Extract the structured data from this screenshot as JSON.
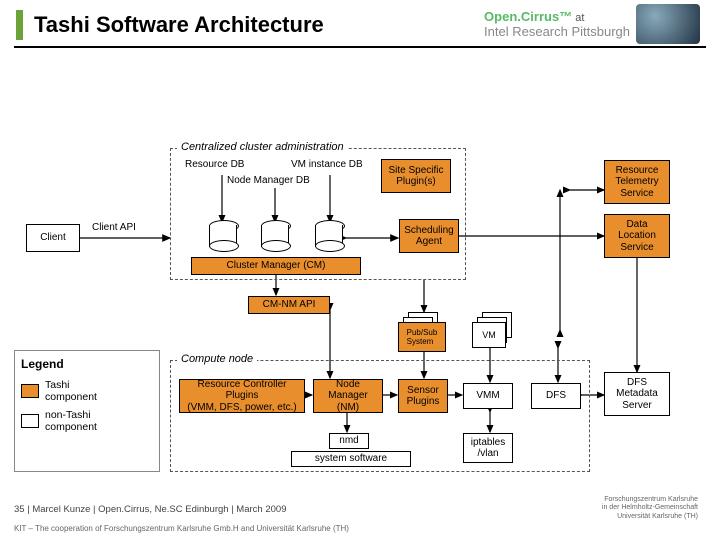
{
  "title": "Tashi Software Architecture",
  "header": {
    "brand1_pre": "Open",
    "brand1_post": "Cirrus™",
    "joiner": "at",
    "brand2": "Intel Research Pittsburgh"
  },
  "groups": {
    "admin": "Centralized cluster administration",
    "compute": "Compute node"
  },
  "labels": {
    "resource_db": "Resource DB",
    "vm_db": "VM instance DB",
    "node_mgr_db": "Node Manager DB",
    "site_plugins": "Site Specific\nPlugin(s)",
    "client_api": "Client API",
    "scheduling_agent": "Scheduling\nAgent",
    "cluster_manager": "Cluster Manager (CM)",
    "cm_nm_api": "CM-NM API",
    "pub_sub": "Pub/Sub\nSystem",
    "vm": "VM",
    "client": "Client",
    "rc_plugins": "Resource Controller Plugins\n(VMM, DFS, power, etc.)",
    "node_manager": "Node Manager\n(NM)",
    "sensor_plugins": "Sensor\nPlugins",
    "vmm": "VMM",
    "dfs": "DFS",
    "nmd": "nmd",
    "system_software": "system software",
    "res_telemetry": "Resource\nTelemetry\nService",
    "data_loc": "Data\nLocation\nService",
    "dfs_meta": "DFS\nMetadata\nServer",
    "iptables": "iptables\n/vlan"
  },
  "legend": {
    "title": "Legend",
    "tashi": "Tashi\ncomponent",
    "non_tashi": "non-Tashi\ncomponent"
  },
  "footer": {
    "main": "35 | Marcel Kunze | Open.Cirrus, Ne.SC Edinburgh | March 2009",
    "sub": "KIT – The cooperation of Forschungszentrum Karlsruhe Gmb.H and Universität Karlsruhe (TH)",
    "right1": "Forschungszentrum Karlsruhe",
    "right2": "in der Helmholtz-Gemeinschaft",
    "right3": "Universität Karlsruhe (TH)"
  }
}
